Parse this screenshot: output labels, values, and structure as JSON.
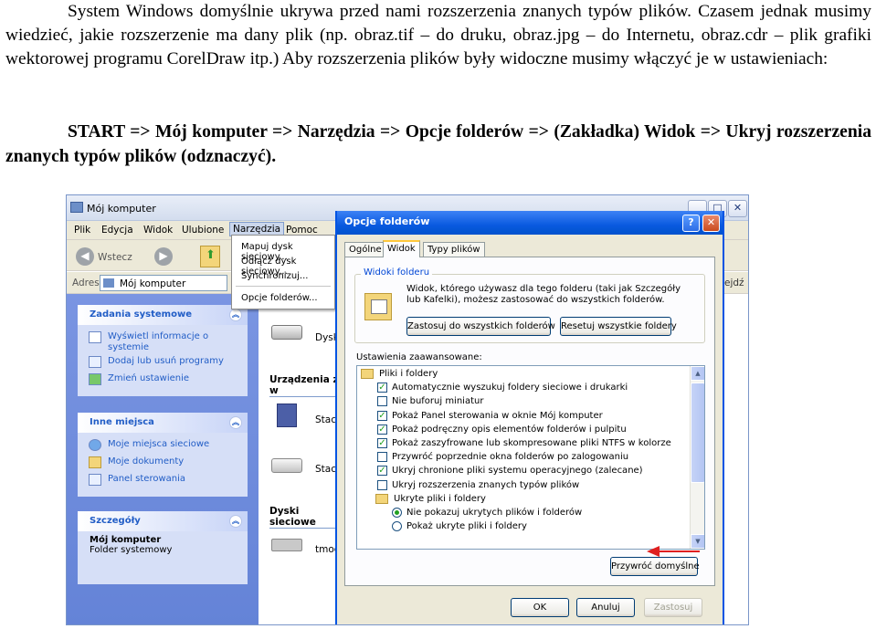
{
  "doc": {
    "paragraph": "System Windows domyślnie ukrywa przed nami rozszerzenia znanych typów plików. Czasem jednak musimy wiedzieć, jakie rozszerzenie ma dany plik (np. obraz.tif – do druku, obraz.jpg – do Internetu, obraz.cdr – plik grafiki wektorowej programu CorelDraw itp.) Aby rozszerzenia plików były widoczne musimy włączyć je w ustawieniach:",
    "path": "START => Mój komputer => Narzędzia => Opcje folderów => (Zakładka) Widok => Ukryj rozszerzenia znanych typów plików (odznaczyć)."
  },
  "explorer": {
    "title": "Mój komputer",
    "menu": [
      "Plik",
      "Edycja",
      "Widok",
      "Ulubione",
      "Narzędzia",
      "Pomoc"
    ],
    "back_label": "Wstecz",
    "address_label": "Adres",
    "address_value": "Mój komputer",
    "right_fragment": "ejdź",
    "tools_menu": [
      "Mapuj dysk sieciowy...",
      "Odłącz dysk sieciowy...",
      "Synchronizuj...",
      "Opcje folderów..."
    ],
    "panels": {
      "system_tasks": {
        "title": "Zadania systemowe",
        "items": [
          "Wyświetl informacje o systemie",
          "Dodaj lub usuń programy",
          "Zmień ustawienie"
        ]
      },
      "other_places": {
        "title": "Inne miejsca",
        "items": [
          "Moje miejsca sieciowe",
          "Moje dokumenty",
          "Panel sterowania"
        ]
      },
      "details": {
        "title": "Szczegóły",
        "name": "Mój komputer",
        "subtitle": "Folder systemowy"
      }
    },
    "content": {
      "drive1": "Dysk",
      "section_devices": "Urządzenia z w",
      "drive2": "Stacj",
      "drive3": "Stacj",
      "section_network": "Dyski sieciowe",
      "drive4": "tmod"
    }
  },
  "dialog": {
    "title": "Opcje folderów",
    "help": "?",
    "close": "✕",
    "tabs": [
      "Ogólne",
      "Widok",
      "Typy plików"
    ],
    "group_label": "Widoki folderu",
    "group_text": "Widok, którego używasz dla tego folderu (taki jak Szczegóły lub Kafelki), możesz zastosować do wszystkich folderów.",
    "btn_apply_all": "Zastosuj do wszystkich folderów",
    "btn_reset_all": "Resetuj wszystkie foldery",
    "advanced_label": "Ustawienia zaawansowane:",
    "tree": [
      {
        "kind": "folder",
        "label": "Pliki i foldery"
      },
      {
        "kind": "check",
        "checked": true,
        "label": "Automatycznie wyszukuj foldery sieciowe i drukarki"
      },
      {
        "kind": "check",
        "checked": false,
        "label": "Nie buforuj miniatur"
      },
      {
        "kind": "check",
        "checked": true,
        "label": "Pokaż Panel sterowania w oknie Mój komputer"
      },
      {
        "kind": "check",
        "checked": true,
        "label": "Pokaż podręczny opis elementów folderów i pulpitu"
      },
      {
        "kind": "check",
        "checked": true,
        "label": "Pokaż zaszyfrowane lub skompresowane pliki NTFS w kolorze"
      },
      {
        "kind": "check",
        "checked": false,
        "label": "Przywróć poprzednie okna folderów po zalogowaniu"
      },
      {
        "kind": "check",
        "checked": true,
        "label": "Ukryj chronione pliki systemu operacyjnego (zalecane)"
      },
      {
        "kind": "check",
        "checked": false,
        "label": "Ukryj rozszerzenia znanych typów plików"
      },
      {
        "kind": "folder",
        "label": "Ukryte pliki i foldery"
      },
      {
        "kind": "radio",
        "checked": true,
        "label": "Nie pokazuj ukrytych plików i folderów"
      },
      {
        "kind": "radio",
        "checked": false,
        "label": "Pokaż ukryte pliki i foldery"
      }
    ],
    "check_mark": "✓",
    "btn_restore": "Przywróć domyślne",
    "btn_ok": "OK",
    "btn_cancel": "Anuluj",
    "btn_apply": "Zastosuj",
    "colors": {
      "accent": "#0054e3",
      "arrow": "#e02020",
      "check": "#21a121"
    }
  }
}
